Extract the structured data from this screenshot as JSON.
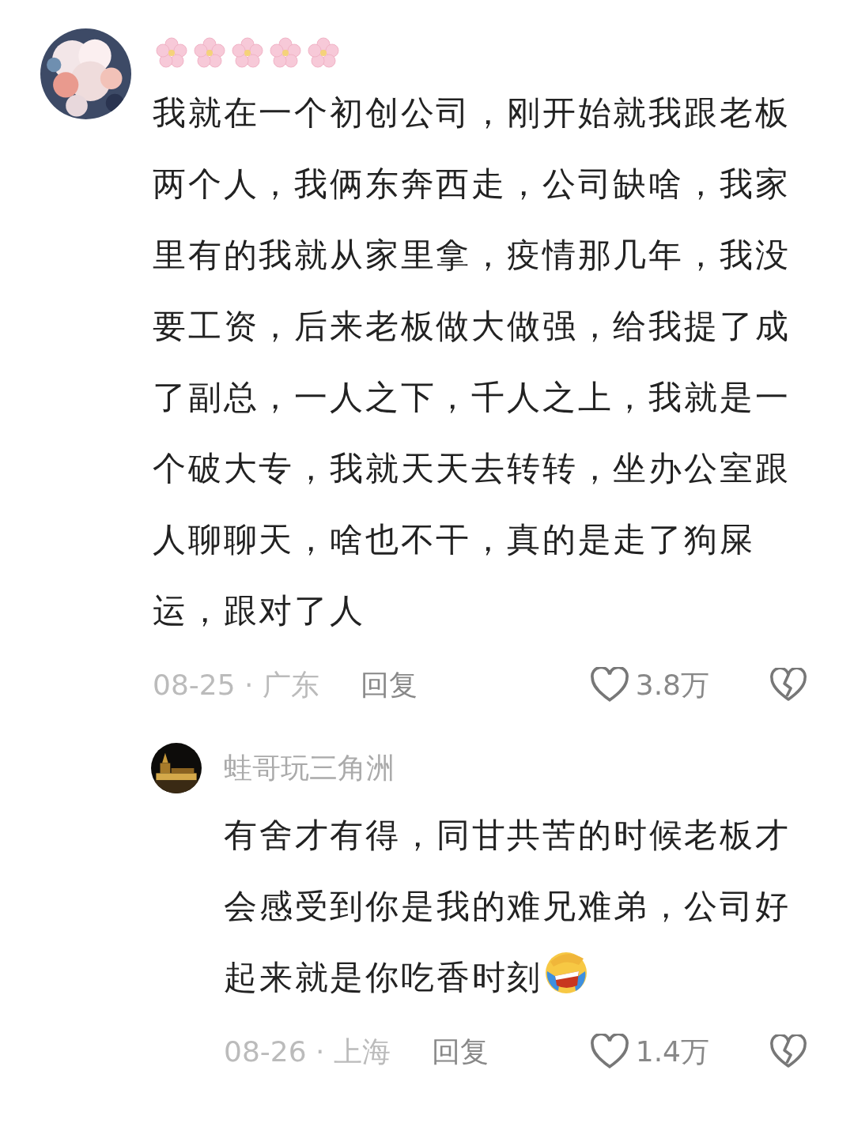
{
  "comments": [
    {
      "text": "我就在一个初创公司，刚开始就我跟老板两个人，我俩东奔西走，公司缺啥，我家里有的我就从家里拿，疫情那几年，我没要工资，后来老板做大做强，给我提了成了副总，一人之下，千人之上，我就是一个破大专，我就天天去转转，坐办公室跟人聊聊天，啥也不干，真的是走了狗屎运，跟对了人",
      "meta": "08-25 · 广东",
      "reply_label": "回复",
      "likes": "3.8万",
      "replies": [
        {
          "author": "蛙哥玩三角洲",
          "text": "有舍才有得，同甘共苦的时候老板才会感受到你是我的难兄难弟，公司好起来就是你吃香时刻",
          "emoji": true,
          "meta": "08-26 · 上海",
          "reply_label": "回复",
          "likes": "1.4万"
        }
      ]
    }
  ]
}
